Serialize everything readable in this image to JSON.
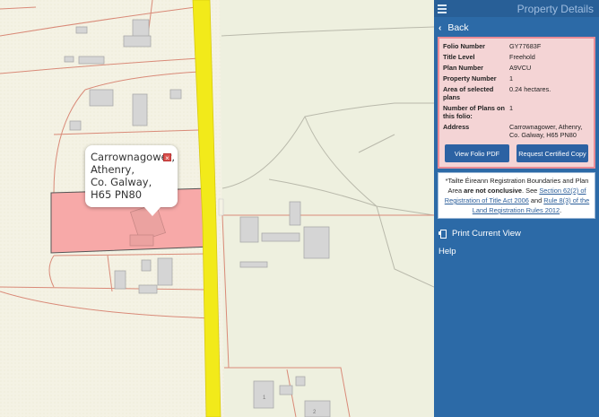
{
  "panel": {
    "title": "Property Details",
    "back_label": "Back",
    "details": [
      {
        "label": "Folio Number",
        "value": "GY77683F"
      },
      {
        "label": "Title Level",
        "value": "Freehold"
      },
      {
        "label": "Plan Number",
        "value": "A9VCU"
      },
      {
        "label": "Property Number",
        "value": "1"
      },
      {
        "label": "Area of selected plans",
        "value": "0.24 hectares."
      },
      {
        "label": "Number of Plans on this folio:",
        "value": "1"
      },
      {
        "label": "Address",
        "value": "Carrownagower, Athenry, Co. Galway, H65 PN80"
      }
    ],
    "buttons": {
      "view_pdf": "View Folio PDF",
      "request_copy": "Request Certified Copy"
    },
    "notice": {
      "part1": "*Tailte Éireann Registration Boundaries and Plan Area ",
      "bold": "are not conclusive",
      "part2": ". See ",
      "link1": "Section 62(2) of Registration of Title Act 2006",
      "part3": " and ",
      "link2": "Rule 8(3) of the Land Registration Rules 2012",
      "part4": "."
    },
    "menu": {
      "print": "Print Current View",
      "help": "Help"
    }
  },
  "map": {
    "popup_address": "Carrownagower,\nAthenry,\nCo. Galway,\nH65 PN80",
    "parcel_numbers": [
      "1",
      "2"
    ],
    "colors": {
      "road": "#f2ea1a",
      "selected_parcel": "#f7a9a8",
      "boundary": "#d98a78",
      "background": "#f4f2e4"
    }
  }
}
